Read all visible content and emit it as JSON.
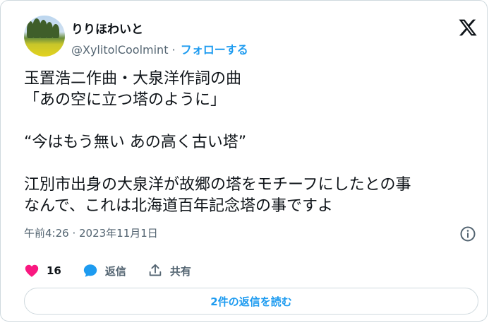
{
  "author": {
    "name": "りりほわいと",
    "handle": "@XylitolCoolmint",
    "separator": "·",
    "follow_label": "フォローする"
  },
  "tweet": {
    "text": "玉置浩二作曲・大泉洋作詞の曲\n「あの空に立つ塔のように」\n\n“今はもう無い あの高く古い塔”\n\n江別市出身の大泉洋が故郷の塔をモチーフにしたとの事\nなんで、これは北海道百年記念塔の事ですよ",
    "timestamp": "午前4:26 · 2023年11月1日"
  },
  "actions": {
    "likes": "16",
    "reply_label": "返信",
    "share_label": "共有"
  },
  "replies_button_label": "2件の返信を読む",
  "colors": {
    "accent": "#1d9bf0",
    "like": "#f91880",
    "muted": "#536471",
    "border": "#cfd9de"
  },
  "icons": [
    "x-logo-icon",
    "info-icon",
    "heart-icon",
    "reply-bubble-icon",
    "share-icon"
  ]
}
